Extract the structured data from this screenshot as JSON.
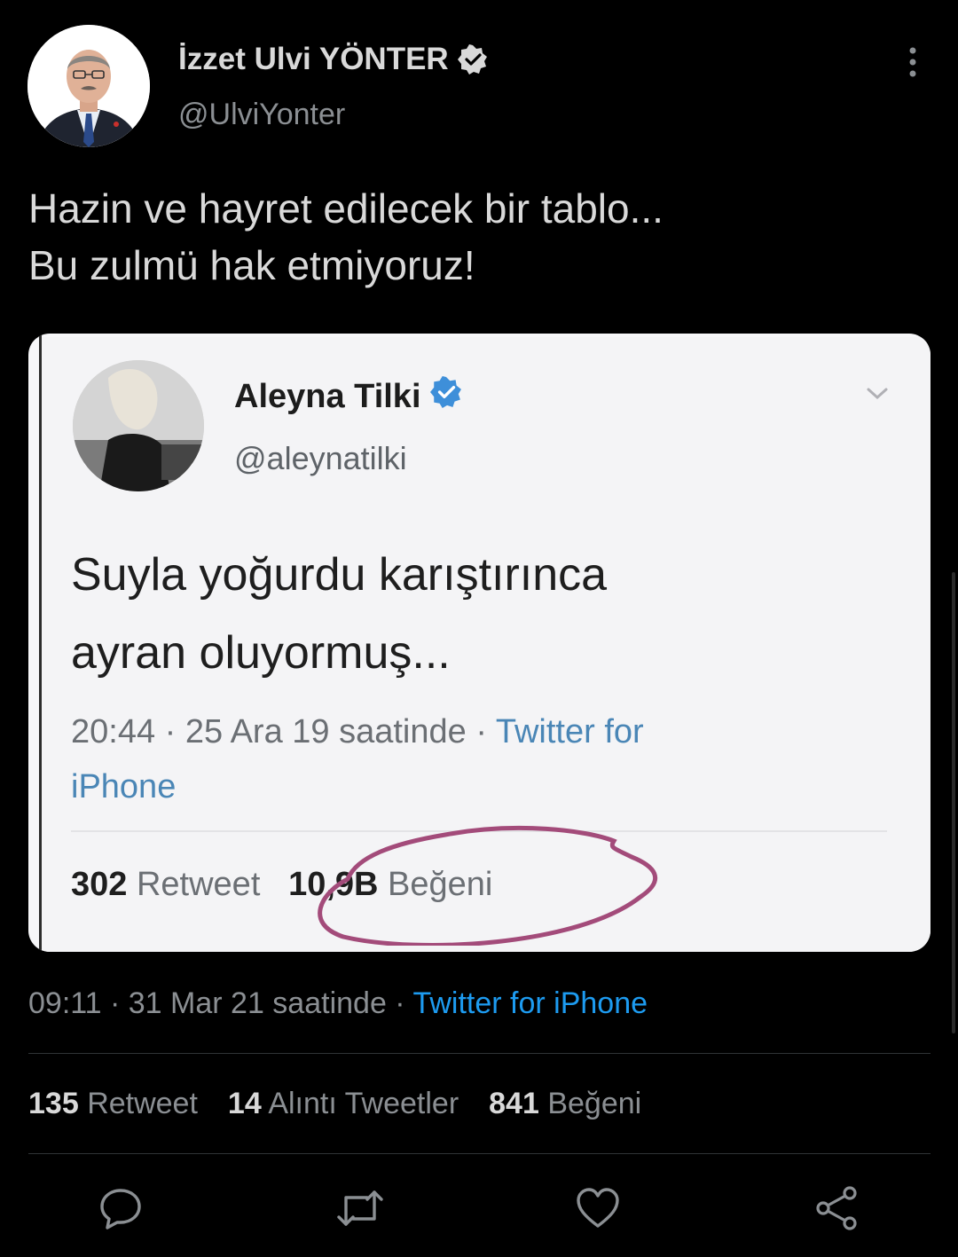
{
  "author": {
    "name": "İzzet Ulvi YÖNTER",
    "handle": "@UlviYonter",
    "verified": true
  },
  "tweet": {
    "lines": [
      "Hazin ve hayret edilecek bir tablo...",
      "Bu zulmü hak etmiyoruz!"
    ]
  },
  "embedded_image": {
    "name": "Aleyna Tilki",
    "handle": "@aleynatilki",
    "verified": true,
    "text_lines": [
      "Suyla yoğurdu karıştırınca",
      "ayran oluyormuş..."
    ],
    "meta_time": "20:44 · 25 Ara 19 saatinde · ",
    "meta_source_1": "Twitter for",
    "meta_source_2": "iPhone",
    "retweets_count": "302",
    "retweets_label": "Retweet",
    "likes_count": "10,9B",
    "likes_label": "Beğeni"
  },
  "meta": {
    "time": "09:11 · 31 Mar 21 saatinde · ",
    "source": "Twitter for iPhone"
  },
  "stats": {
    "retweets_count": "135",
    "retweets_label": "Retweet",
    "quotes_count": "14",
    "quotes_label": "Alıntı Tweetler",
    "likes_count": "841",
    "likes_label": "Beğeni"
  },
  "actions": [
    "reply-icon",
    "retweet-icon",
    "like-icon",
    "share-icon"
  ],
  "colors": {
    "background": "#000000",
    "text": "#d9d9d9",
    "muted": "#8b8f93",
    "accent": "#1d9bf0",
    "verified": "#d9d9d9",
    "embedded_verified": "#1d9bf0",
    "annotation": "#a34b7a"
  }
}
